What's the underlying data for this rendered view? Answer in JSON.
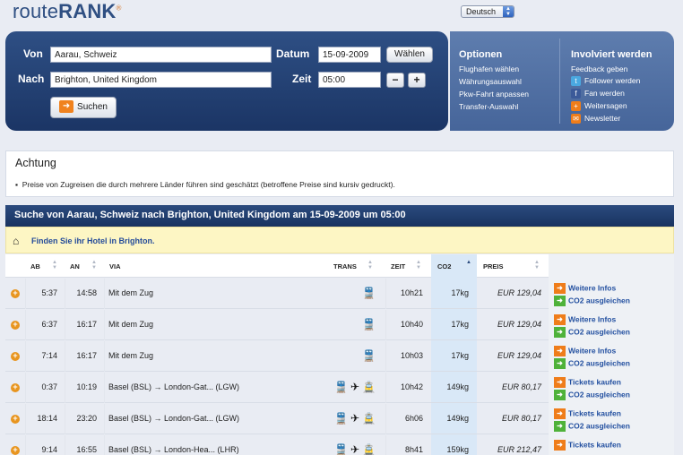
{
  "brand": {
    "name_light": "route",
    "name_bold": "RANK",
    "mark": "®"
  },
  "language": {
    "selected": "Deutsch"
  },
  "search": {
    "von_label": "Von",
    "von_value": "Aarau, Schweiz",
    "nach_label": "Nach",
    "nach_value": "Brighton, United Kingdom",
    "datum_label": "Datum",
    "datum_value": "15-09-2009",
    "waehlen_label": "Wählen",
    "zeit_label": "Zeit",
    "zeit_value": "05:00",
    "minus_label": "−",
    "plus_label": "+",
    "suchen_label": "Suchen"
  },
  "options": {
    "title": "Optionen",
    "links": [
      "Flughafen wählen",
      "Währungsauswahl",
      "Pkw-Fahrt anpassen",
      "Transfer-Auswahl"
    ]
  },
  "involved": {
    "title": "Involviert werden",
    "links": [
      {
        "label": "Feedback geben",
        "icon": ""
      },
      {
        "label": "Follower werden",
        "icon": "twitter-icon"
      },
      {
        "label": "Fan werden",
        "icon": "facebook-icon"
      },
      {
        "label": "Weitersagen",
        "icon": "share-icon"
      },
      {
        "label": "Newsletter",
        "icon": "mail-icon"
      }
    ]
  },
  "notice": {
    "title": "Achtung",
    "text": "Preise von Zugreisen die durch mehrere Länder führen sind geschätzt (betroffene Preise sind kursiv gedruckt)."
  },
  "results": {
    "heading": "Suche von Aarau, Schweiz nach Brighton, United Kingdom am 15-09-2009 um 05:00",
    "hotel_text": "Finden Sie ihr Hotel in Brighton.",
    "columns": {
      "ab": "AB",
      "an": "AN",
      "via": "VIA",
      "trans": "TRANS",
      "zeit": "ZEIT",
      "co2": "CO2",
      "preis": "PREIS"
    },
    "rows": [
      {
        "ab": "5:37",
        "an": "14:58",
        "via": "Mit dem Zug",
        "trans": [
          "train-icon"
        ],
        "zeit": "10h21",
        "co2": "17kg",
        "preis": "EUR 129,04",
        "italic": true,
        "action": "Weitere Infos",
        "co2_action": "CO2 ausgleichen"
      },
      {
        "ab": "6:37",
        "an": "16:17",
        "via": "Mit dem Zug",
        "trans": [
          "train-icon"
        ],
        "zeit": "10h40",
        "co2": "17kg",
        "preis": "EUR 129,04",
        "italic": true,
        "action": "Weitere Infos",
        "co2_action": "CO2 ausgleichen"
      },
      {
        "ab": "7:14",
        "an": "16:17",
        "via": "Mit dem Zug",
        "trans": [
          "train-icon"
        ],
        "zeit": "10h03",
        "co2": "17kg",
        "preis": "EUR 129,04",
        "italic": true,
        "action": "Weitere Infos",
        "co2_action": "CO2 ausgleichen"
      },
      {
        "ab": "0:37",
        "an": "10:19",
        "via": "Basel (BSL) → London-Gat... (LGW)",
        "trans": [
          "train-icon",
          "plane-icon",
          "tram-icon"
        ],
        "zeit": "10h42",
        "co2": "149kg",
        "preis": "EUR 80,17",
        "italic": true,
        "action": "Tickets kaufen",
        "co2_action": "CO2 ausgleichen"
      },
      {
        "ab": "18:14",
        "an": "23:20",
        "via": "Basel (BSL) → London-Gat... (LGW)",
        "trans": [
          "train-icon",
          "plane-icon",
          "tram-icon"
        ],
        "zeit": "6h06",
        "co2": "149kg",
        "preis": "EUR 80,17",
        "italic": true,
        "action": "Tickets kaufen",
        "co2_action": "CO2 ausgleichen"
      },
      {
        "ab": "9:14",
        "an": "16:55",
        "via": "Basel (BSL) → London-Hea... (LHR)",
        "trans": [
          "train-icon",
          "plane-icon",
          "tram-icon"
        ],
        "zeit": "8h41",
        "co2": "159kg",
        "preis": "EUR 212,47",
        "italic": true,
        "action": "Tickets kaufen",
        "co2_action": ""
      }
    ]
  }
}
